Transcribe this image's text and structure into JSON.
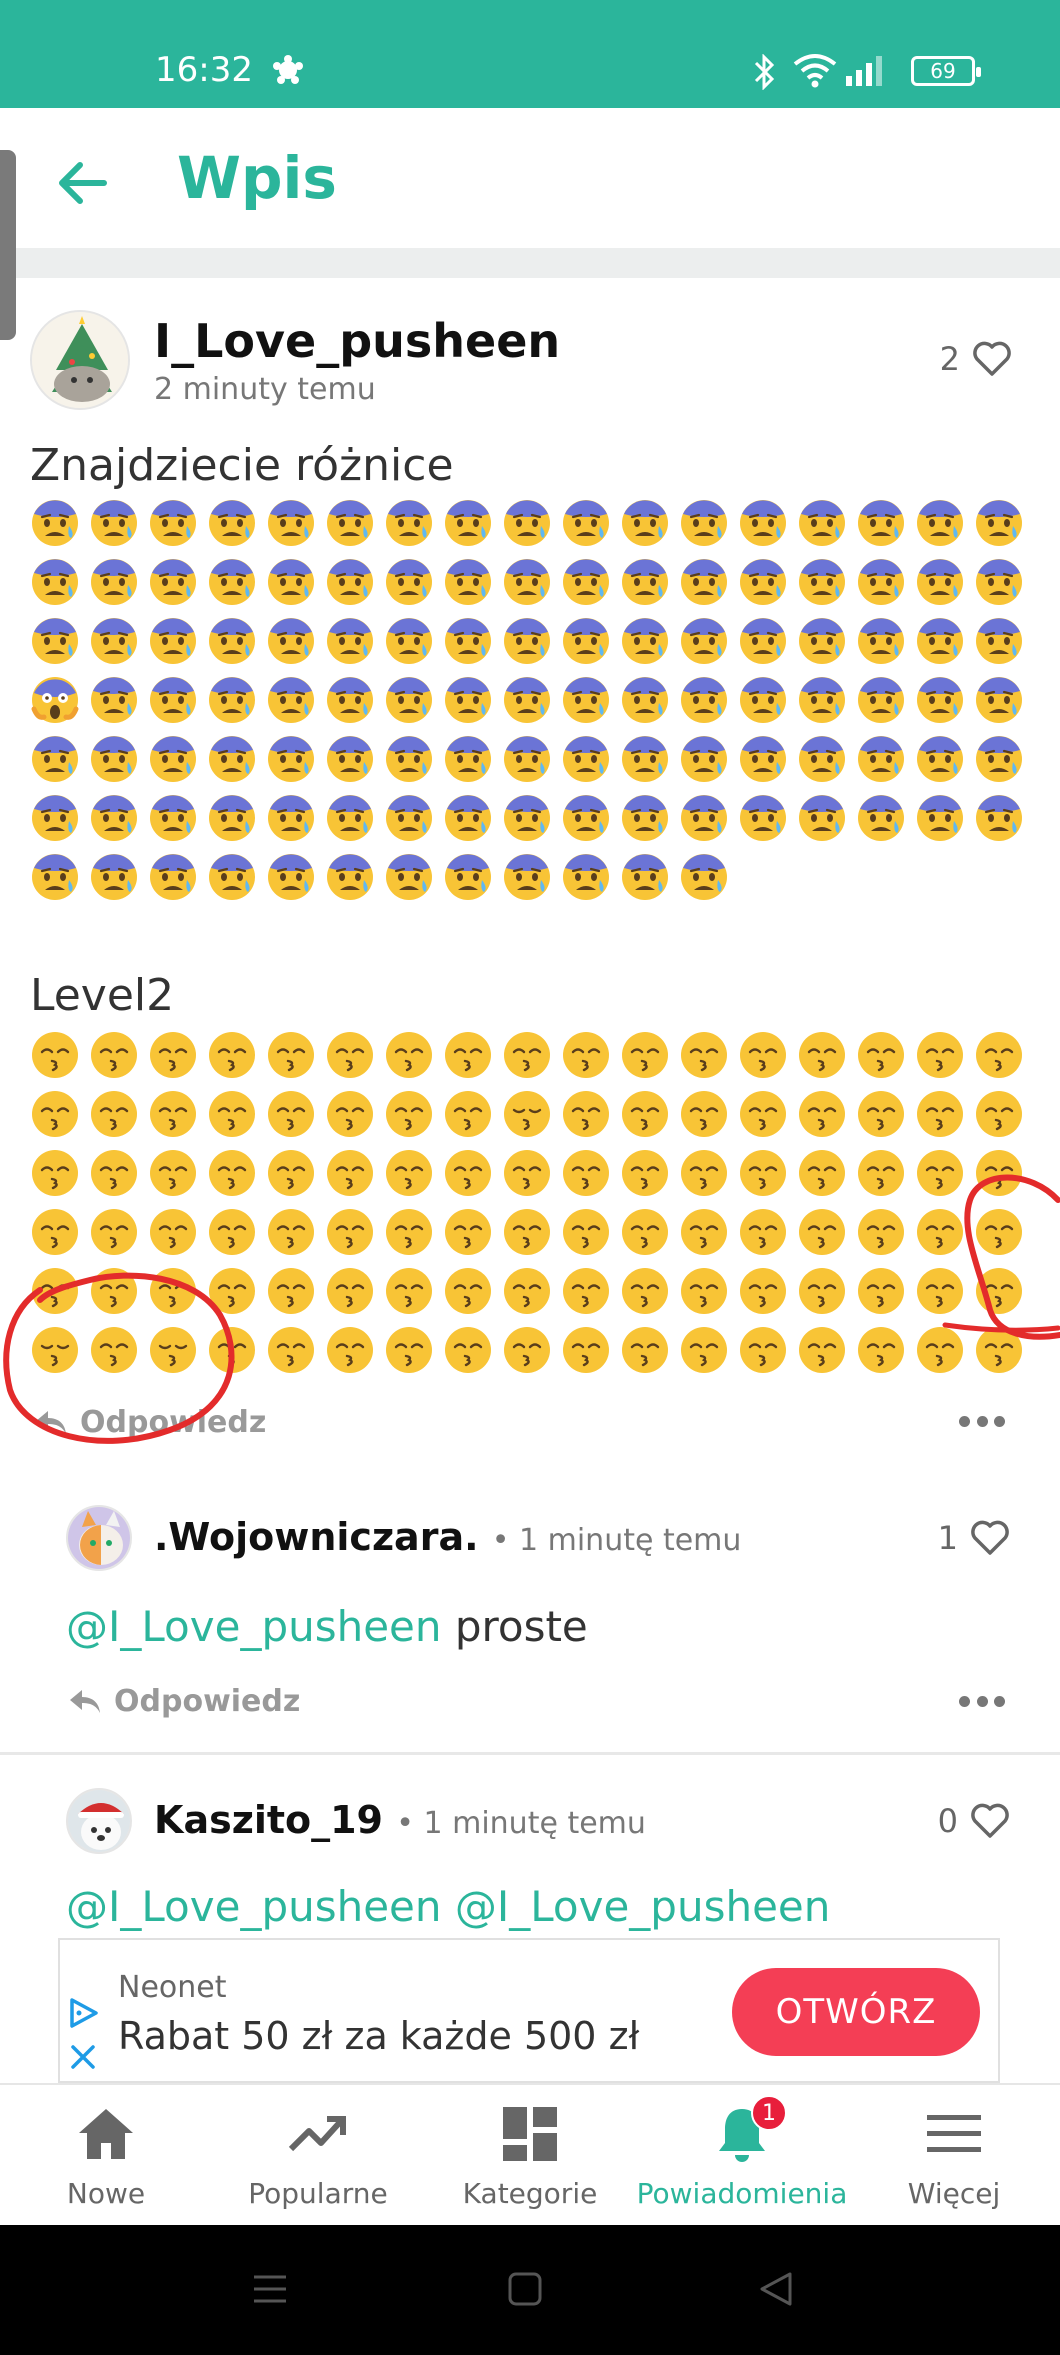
{
  "status_bar": {
    "time": "16:32",
    "battery": "69"
  },
  "header": {
    "title": "Wpis"
  },
  "post": {
    "username": "I_Love_pusheen",
    "time_ago": "2 minuty temu",
    "likes": "2",
    "text1": "Znajdziecie różnice",
    "text2": "Level2",
    "reply_label": "Odpowiedz"
  },
  "grid1": {
    "rows": 7,
    "cols": 17,
    "last_row_count": 12,
    "base_emoji": "anxious-face-with-sweat",
    "odd_emoji": "face-screaming-in-fear",
    "odd_position": "row 4, col 1"
  },
  "grid2": {
    "rows": 6,
    "cols": 17,
    "base_emoji": "kissing-face-with-smiling-eyes",
    "odd_emoji": "kissing-face-with-closed-eyes",
    "odd_positions": [
      "row 2, col 9",
      "row 6, col 1",
      "row 6, col 3"
    ]
  },
  "comments": [
    {
      "username": ".Wojowniczara.",
      "time_ago": "• 1 minutę temu",
      "likes": "1",
      "mention": "@I_Love_pusheen",
      "text": " proste",
      "reply_label": "Odpowiedz"
    },
    {
      "username": "Kaszito_19",
      "time_ago": "• 1 minutę temu",
      "likes": "0",
      "mention": "@I_Love_pusheen @I_Love_pusheen",
      "text": ""
    }
  ],
  "ad": {
    "sponsor": "Neonet",
    "headline": "Rabat 50 zł za każde 500 zł",
    "cta": "OTWÓRZ"
  },
  "bottom_nav": [
    {
      "label": "Nowe",
      "icon": "home-icon"
    },
    {
      "label": "Popularne",
      "icon": "trending-icon"
    },
    {
      "label": "Kategorie",
      "icon": "grid-icon"
    },
    {
      "label": "Powiadomienia",
      "icon": "bell-icon",
      "badge": "1",
      "active": true
    },
    {
      "label": "Więcej",
      "icon": "menu-icon"
    }
  ],
  "colors": {
    "accent": "#2bb59b",
    "cta": "#f43e55",
    "annotation_red": "#e32b2b"
  }
}
